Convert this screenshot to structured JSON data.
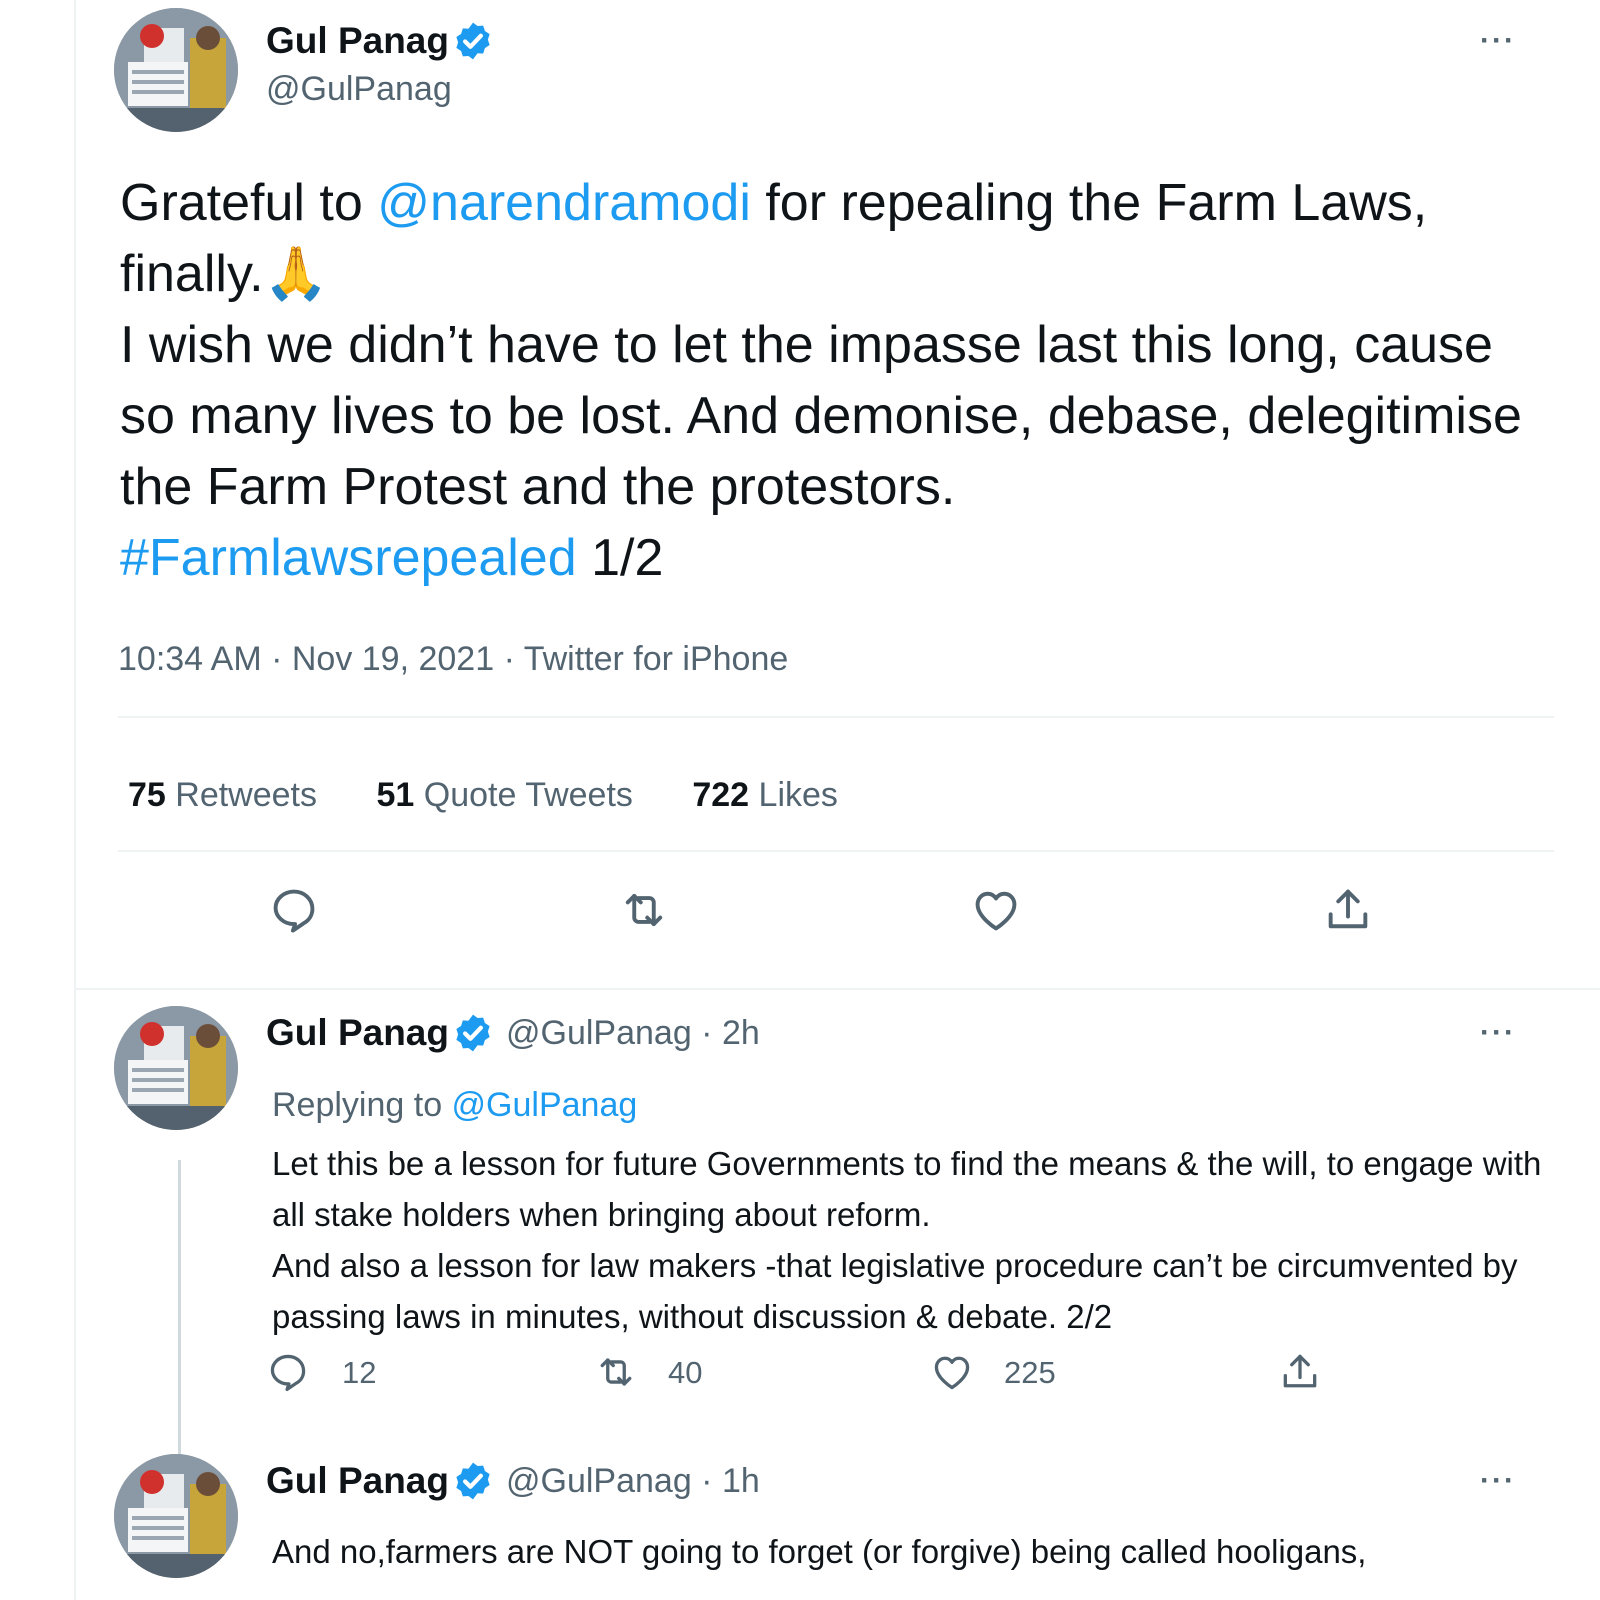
{
  "main_tweet": {
    "author_name": "Gul Panag",
    "author_handle": "@GulPanag",
    "more_label": "···",
    "text_prefix": "Grateful to ",
    "mention": "@narendramodi",
    "text_line1_rest": " for repealing the Farm Laws, finally.",
    "emoji": "🙏",
    "text_body": "I wish we didn’t have to let the impasse last this long, cause so many lives to be lost. And demonise, debase, delegitimise the Farm Protest and the protestors.",
    "hashtag": "#Farmlawsrepealed",
    "thread_marker": " 1/2",
    "timestamp": "10:34 AM · Nov 19, 2021 · Twitter for iPhone",
    "stats": {
      "retweets_count": "75",
      "retweets_label": " Retweets",
      "quotes_count": "51",
      "quotes_label": " Quote Tweets",
      "likes_count": "722",
      "likes_label": " Likes"
    },
    "actions": [
      "reply-icon",
      "retweet-icon",
      "like-icon",
      "share-icon"
    ]
  },
  "reply_tweet": {
    "author_name": "Gul Panag",
    "author_handle": "@GulPanag · 2h",
    "more_label": "···",
    "replying_prefix": "Replying to ",
    "replying_to": "@GulPanag",
    "text": "Let this be a lesson for future Governments to find the means & the will, to engage with all stake holders when bringing about reform.\nAnd also a lesson for law makers -that legislative procedure can’t be circumvented by passing laws in minutes, without discussion & debate.  2/2",
    "replies": "12",
    "retweets": "40",
    "likes": "225"
  },
  "third_tweet": {
    "author_name": "Gul Panag",
    "author_handle": "@GulPanag · 1h",
    "more_label": "···",
    "text": "And no,farmers are NOT going to forget (or forgive) being called hooligans,"
  },
  "colors": {
    "link": "#1d9bf0",
    "secondary": "#536471",
    "primary": "#0f1419",
    "divider": "#eff3f4"
  }
}
